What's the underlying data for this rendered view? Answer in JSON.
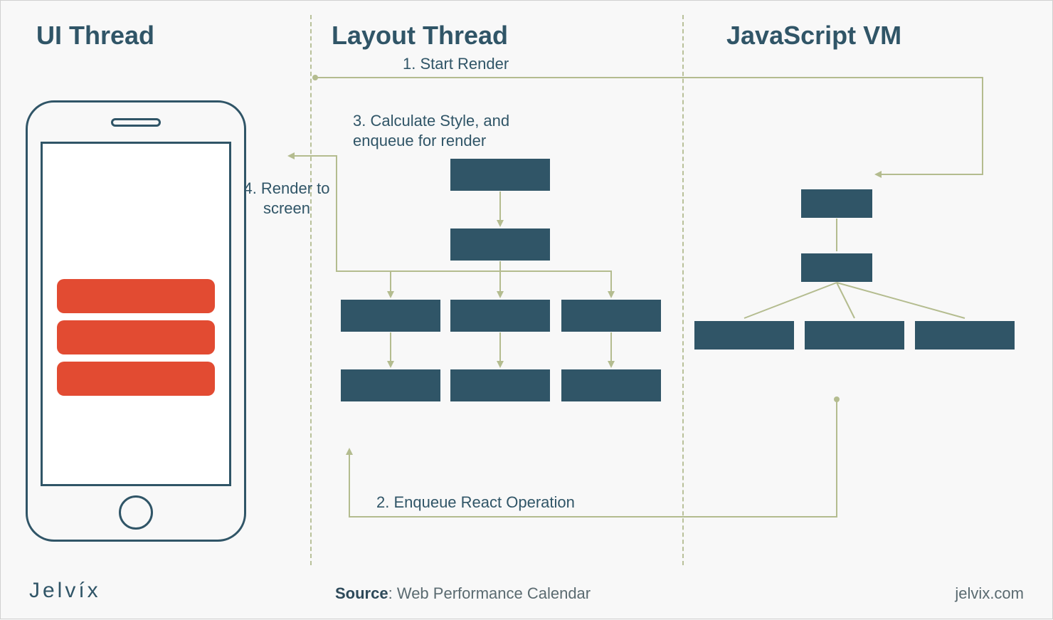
{
  "columns": {
    "ui": "UI Thread",
    "layout": "Layout Thread",
    "jsvm": "JavaScript VM"
  },
  "steps": {
    "s1": "1. Start Render",
    "s2": "2. Enqueue React Operation",
    "s3_line1": "3. Calculate Style, and",
    "s3_line2": "enqueue for render",
    "s4_line1": "4. Render to",
    "s4_line2": "screen"
  },
  "footer": {
    "source_label": "Source",
    "source_value": "Web Performance Calendar",
    "site": "jelvix.com",
    "brand": "Jelvíx"
  },
  "colors": {
    "node": "#305567",
    "accent": "#e24b32",
    "olive": "#b4bc8f"
  }
}
